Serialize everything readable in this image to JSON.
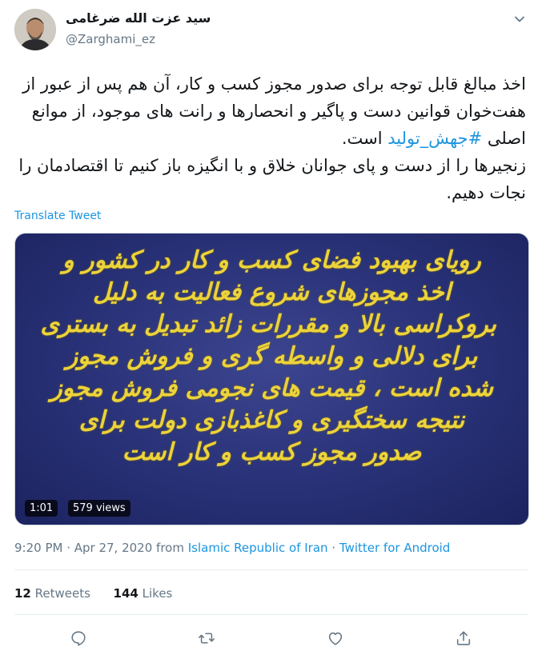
{
  "header": {
    "display_name": "سید عزت الله ضرغامی",
    "handle": "@Zarghami_ez",
    "menu_icon": "chevron-down-icon"
  },
  "tweet": {
    "text_before_hashtag": "اخذ مبالغ قابل توجه برای صدور مجوز کسب و کار، آن هم پس از عبور از هفت‌خوان قوانین دست و پاگیر و انحصارها و رانت های موجود، از موانع اصلی ",
    "hashtag": "#جهش_تولید",
    "text_after_hashtag": " است.",
    "text_second_paragraph": "زنجیرها را از دست و پای جوانان خلاق و با انگیزه باز کنیم تا اقتصادمان را نجات دهیم.",
    "translate_label": "Translate Tweet"
  },
  "media": {
    "lines": [
      "رویای بهبود فضای کسب و کار در کشور و",
      "اخذ مجوزهای شروع فعالیت به دلیل",
      "بروکراسی بالا و مقررات زائد تبدیل به بستری",
      "برای دلالی و واسطه گری و فروش مجوز",
      "شده است ، قیمت های نجومی فروش مجوز",
      "نتیجه سختگیری و کاغذبازی دولت برای",
      "صدور مجوز کسب و کار است"
    ],
    "duration": "1:01",
    "views": "579 views"
  },
  "meta": {
    "timestamp": "9:20 PM · Apr 27, 2020",
    "from_word": "from",
    "location": "Islamic Republic of Iran",
    "separator": "·",
    "client": "Twitter for Android"
  },
  "stats": {
    "retweets_count": "12",
    "retweets_label": "Retweets",
    "likes_count": "144",
    "likes_label": "Likes"
  },
  "actions": [
    "reply-icon",
    "retweet-icon",
    "like-icon",
    "share-icon"
  ],
  "colors": {
    "accent": "#1b95e0",
    "secondary_text": "#657786",
    "media_bg": "#283176",
    "media_text": "#ecd33a"
  }
}
